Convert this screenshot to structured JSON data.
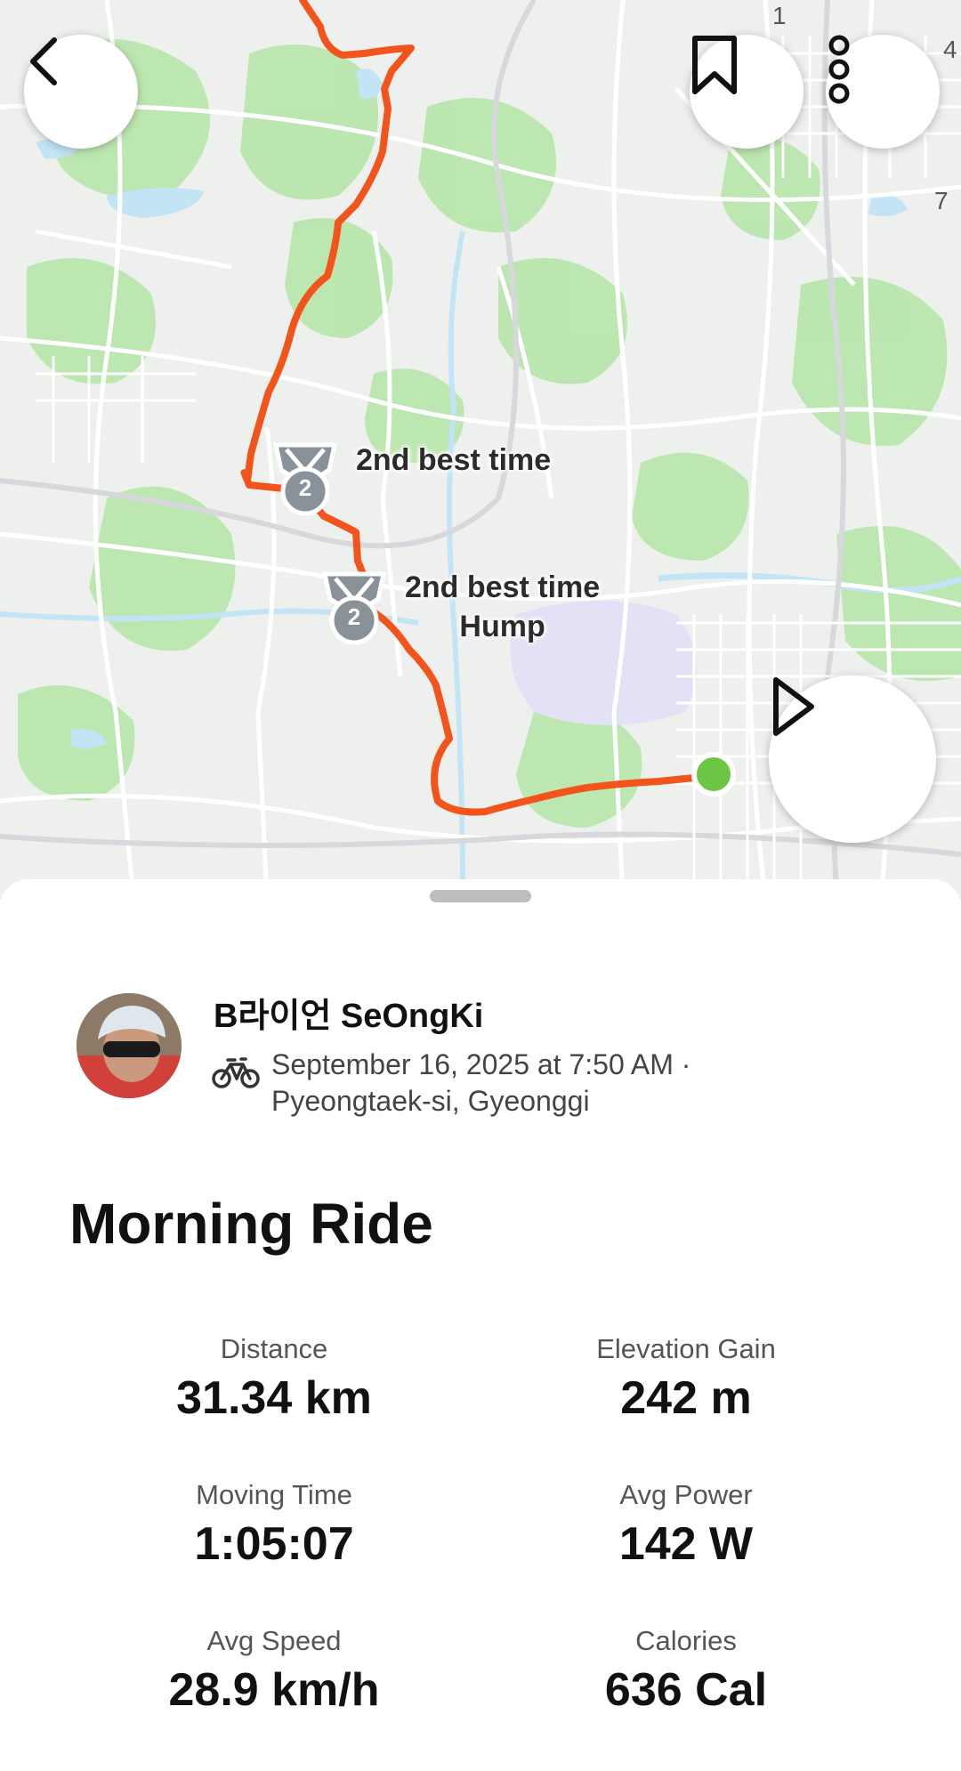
{
  "map": {
    "segments": [
      {
        "label": "2nd best time",
        "name": "",
        "rank": "2"
      },
      {
        "label": "2nd best time",
        "name": "Hump",
        "rank": "2"
      }
    ],
    "edge_numbers": [
      "1",
      "4",
      "7"
    ],
    "colors": {
      "route": "#f2541b",
      "end_marker": "#6cc644",
      "park": "#a6e39a",
      "water": "#bfe3f6"
    }
  },
  "header": {
    "back_icon": "chevron-left-icon",
    "bookmark_icon": "bookmark-icon",
    "more_icon": "more-vertical-icon",
    "play_icon": "play-icon"
  },
  "activity": {
    "athlete_name": "B라이언 SeOngKi",
    "sport_icon": "bike-icon",
    "date": "September 16, 2025 at 7:50 AM ·",
    "location": "Pyeongtaek-si, Gyeonggi",
    "title": "Morning Ride"
  },
  "stats": [
    {
      "label": "Distance",
      "value": "31.34 km"
    },
    {
      "label": "Elevation Gain",
      "value": "242 m"
    },
    {
      "label": "Moving Time",
      "value": "1:05:07"
    },
    {
      "label": "Avg Power",
      "value": "142 W"
    },
    {
      "label": "Avg Speed",
      "value": "28.9 km/h"
    },
    {
      "label": "Calories",
      "value": "636 Cal"
    }
  ]
}
